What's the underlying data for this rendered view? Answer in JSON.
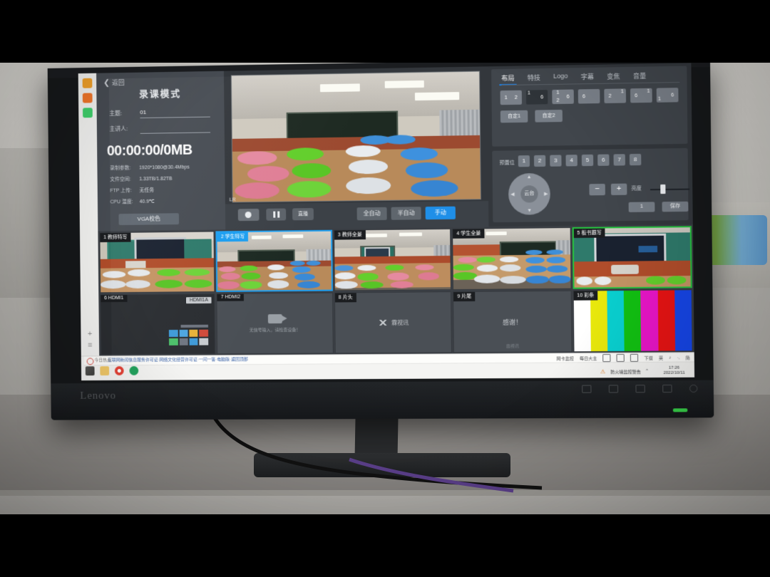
{
  "device": {
    "monitor_brand": "Lenovo"
  },
  "browser_sidebar": {
    "icons": [
      "star-icon",
      "app-icon",
      "note-icon"
    ],
    "add": "+",
    "menu": "≡"
  },
  "left_panel": {
    "back_label": "返回",
    "title": "录课模式",
    "subject_label": "主题:",
    "subject_value": "01",
    "host_label": "主讲人:",
    "host_value": "",
    "timer": "00:00:00/0MB",
    "stats": [
      {
        "key": "录制参数:",
        "value": "1920*1080@30.4Mbps"
      },
      {
        "key": "文件空间:",
        "value": "1.33TB/1.82TB"
      },
      {
        "key": "FTP 上传:",
        "value": "无任务"
      },
      {
        "key": "CPU 温度:",
        "value": "40.9℃"
      }
    ],
    "vga_button": "VGA校色"
  },
  "preview": {
    "audio_label": "LR",
    "record_button": "record-button",
    "pause_button": "pause-button",
    "live_button": "直播",
    "modes": [
      {
        "label": "全自动",
        "active": false
      },
      {
        "label": "半自动",
        "active": false
      },
      {
        "label": "手动",
        "active": true
      }
    ]
  },
  "right_panel": {
    "tabs": [
      {
        "label": "布局",
        "active": true
      },
      {
        "label": "特技",
        "active": false
      },
      {
        "label": "Logo",
        "active": false
      },
      {
        "label": "字幕",
        "active": false
      },
      {
        "label": "变焦",
        "active": false
      },
      {
        "label": "音量",
        "active": false
      }
    ],
    "layouts": [
      {
        "cells": [
          "1",
          "2"
        ]
      },
      {
        "cells": [
          "1",
          "6"
        ]
      },
      {
        "cells": [
          "1",
          "2",
          "6"
        ]
      },
      {
        "cells": [
          "6"
        ]
      },
      {
        "cells": [
          "2",
          "1"
        ]
      },
      {
        "cells": [
          "6",
          "1"
        ]
      },
      {
        "cells": [
          "6",
          "1"
        ]
      }
    ],
    "custom_buttons": [
      "自定1",
      "自定2"
    ],
    "preset_label": "预置位",
    "presets": [
      "1",
      "2",
      "3",
      "4",
      "5",
      "6",
      "7",
      "8"
    ],
    "ptz_label": "云台",
    "zoom_minus": "−",
    "zoom_plus": "+",
    "brightness_label": "亮度",
    "number_value": "1",
    "save_button": "保存"
  },
  "thumbnails": [
    {
      "num": "1",
      "name": "教师特写",
      "type": "scene-teacher-close",
      "state": "normal",
      "corner": ""
    },
    {
      "num": "2",
      "name": "学生特写",
      "type": "scene-student-close",
      "state": "selected",
      "corner": ""
    },
    {
      "num": "3",
      "name": "教师全景",
      "type": "scene-teacher-wide",
      "state": "normal",
      "corner": ""
    },
    {
      "num": "4",
      "name": "学生全景",
      "type": "scene-student-wide",
      "state": "normal",
      "corner": ""
    },
    {
      "num": "5",
      "name": "板书跟写",
      "type": "scene-board",
      "state": "program",
      "corner": ""
    },
    {
      "num": "6",
      "name": "HDMI1",
      "type": "desktop",
      "state": "normal",
      "corner": "HDMI1A"
    },
    {
      "num": "7",
      "name": "HDMI2",
      "type": "no-signal",
      "state": "normal",
      "corner": ""
    },
    {
      "num": "8",
      "name": "片头",
      "type": "logo-card",
      "state": "normal",
      "corner": ""
    },
    {
      "num": "9",
      "name": "片尾",
      "type": "thanks-card",
      "state": "normal",
      "corner": ""
    },
    {
      "num": "10",
      "name": "彩条",
      "type": "color-bars",
      "state": "normal",
      "corner": ""
    }
  ],
  "thumbnail_messages": {
    "no_signal": "无信号输入，请检查设备！",
    "thanks": "感谢！",
    "opening_logo": "霖视讯"
  },
  "color_bars": [
    "#ffffff",
    "#e8e80c",
    "#0ad0d0",
    "#12c112",
    "#e916c8",
    "#e81414",
    "#1646e8"
  ],
  "taskbar": {
    "news_label": "今日热点",
    "news_text": "互联网新闻信息服务许可证·网络文化经营许可证·一问一答·电脑版·返回顶部",
    "tray_items": [
      "网卡监控",
      "每日大主",
      "shield-icon",
      "monitor-icon",
      "download-icon",
      "下载"
    ],
    "ime": [
      "英",
      "♪",
      "·,",
      "简"
    ],
    "notice": "防火墙监控警告",
    "time": "17:26",
    "date": "2022/10/11"
  }
}
